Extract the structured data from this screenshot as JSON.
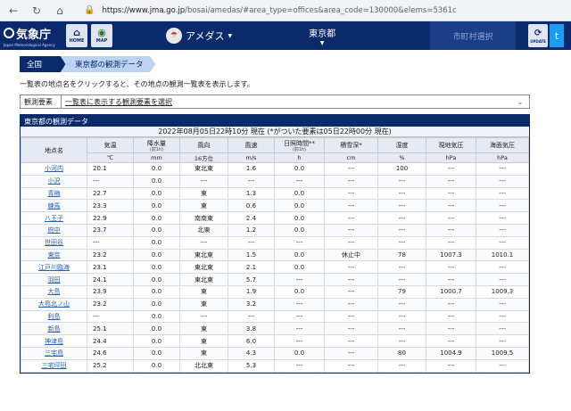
{
  "browser": {
    "url_host": "https://www.jma.go.jp",
    "url_path": "/bosai/amedas/#area_type=offices&area_code=130000&elems=5361c"
  },
  "header": {
    "logo_text": "気象庁",
    "logo_sub": "Japan Meteorological Agency",
    "home_label": "HOME",
    "map_label": "MAP",
    "amedas_label": "アメダス",
    "pref_label": "東京都",
    "region_label": "市町村選択",
    "update_label": "UPDATE",
    "twitter_label": "t"
  },
  "breadcrumb": {
    "root": "全国",
    "current": "東京都の観測データ"
  },
  "intro_text": "一覧表の地点名をクリックすると、その地点の観測一覧表を表示します。",
  "element_select": {
    "label": "観測要素",
    "value": "一覧表に表示する観測要素を選択"
  },
  "panel": {
    "title": "東京都の観測データ",
    "time_text": "2022年08月05日22時10分 現在 (*がついた要素は05日22時00分 現在)"
  },
  "table": {
    "headers": [
      {
        "label": "地点名",
        "sub": ""
      },
      {
        "label": "気温",
        "sub": ""
      },
      {
        "label": "降水量",
        "sub": "(前1h)"
      },
      {
        "label": "風向",
        "sub": ""
      },
      {
        "label": "風速",
        "sub": ""
      },
      {
        "label": "日照時間**",
        "sub": "(前1h)"
      },
      {
        "label": "積雪深*",
        "sub": ""
      },
      {
        "label": "湿度",
        "sub": ""
      },
      {
        "label": "現地気圧",
        "sub": ""
      },
      {
        "label": "海面気圧",
        "sub": ""
      }
    ],
    "units": [
      "",
      "℃",
      "mm",
      "16方位",
      "m/s",
      "h",
      "cm",
      "%",
      "hPa",
      "hPa"
    ],
    "rows": [
      [
        "小河内",
        "20.1",
        "0.0",
        "東北東",
        "1.6",
        "0.0",
        "---",
        "100",
        "---",
        "---"
      ],
      [
        "小沢",
        "---",
        "0.0",
        "---",
        "---",
        "---",
        "---",
        "---",
        "---",
        "---"
      ],
      [
        "青梅",
        "22.7",
        "0.0",
        "東",
        "1.3",
        "0.0",
        "---",
        "---",
        "---",
        "---"
      ],
      [
        "練馬",
        "23.3",
        "0.0",
        "東",
        "0.6",
        "0.0",
        "---",
        "---",
        "---",
        "---"
      ],
      [
        "八王子",
        "22.9",
        "0.0",
        "南南東",
        "2.4",
        "0.0",
        "---",
        "---",
        "---",
        "---"
      ],
      [
        "府中",
        "23.7",
        "0.0",
        "北東",
        "1.2",
        "0.0",
        "---",
        "---",
        "---",
        "---"
      ],
      [
        "世田谷",
        "---",
        "0.0",
        "---",
        "---",
        "---",
        "---",
        "---",
        "---",
        "---"
      ],
      [
        "東京",
        "23.2",
        "0.0",
        "東北東",
        "1.5",
        "0.0",
        "休止中",
        "78",
        "1007.3",
        "1010.1"
      ],
      [
        "江戸川臨海",
        "23.1",
        "0.0",
        "東北東",
        "2.1",
        "0.0",
        "---",
        "---",
        "---",
        "---"
      ],
      [
        "羽田",
        "24.1",
        "0.0",
        "東北東",
        "5.7",
        "---",
        "---",
        "---",
        "---",
        "---"
      ],
      [
        "大島",
        "23.9",
        "0.0",
        "東",
        "1.9",
        "0.0",
        "---",
        "79",
        "1000.7",
        "1009.3"
      ],
      [
        "大島北ノ山",
        "23.2",
        "0.0",
        "東",
        "3.2",
        "---",
        "---",
        "---",
        "---",
        "---"
      ],
      [
        "利島",
        "---",
        "0.0",
        "---",
        "---",
        "---",
        "---",
        "---",
        "---",
        "---"
      ],
      [
        "新島",
        "25.1",
        "0.0",
        "東",
        "3.8",
        "---",
        "---",
        "---",
        "---",
        "---"
      ],
      [
        "神津島",
        "24.4",
        "0.0",
        "東",
        "6.0",
        "---",
        "---",
        "---",
        "---",
        "---"
      ],
      [
        "三宅島",
        "24.6",
        "0.0",
        "東",
        "4.3",
        "0.0",
        "---",
        "80",
        "1004.9",
        "1009.5"
      ],
      [
        "三宅坪田",
        "25.2",
        "0.0",
        "北北東",
        "5.3",
        "---",
        "---",
        "---",
        "---",
        "---"
      ]
    ]
  }
}
